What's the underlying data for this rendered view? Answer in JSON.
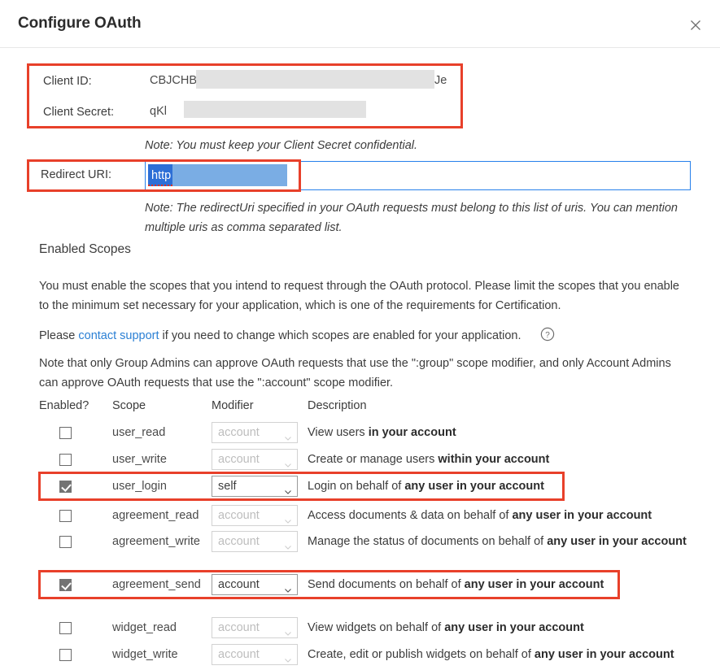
{
  "dialog": {
    "title": "Configure OAuth",
    "close_icon": "close-icon"
  },
  "credentials": {
    "client_id": {
      "label": "Client ID:",
      "value_prefix": "CBJCHBCA",
      "value_suffix": "Je"
    },
    "client_secret": {
      "label": "Client Secret:",
      "value_prefix": "qKl"
    },
    "note": "Note: You must keep your Client Secret confidential."
  },
  "redirect": {
    "label": "Redirect URI:",
    "value": "http",
    "note": "Note: The redirectUri specified in your OAuth requests must belong to this list of uris. You can mention multiple uris as comma separated list."
  },
  "scopes_section": {
    "title": "Enabled Scopes",
    "paragraph_1": "You must enable the scopes that you intend to request through the OAuth protocol. Please limit the scopes that you enable to the minimum set necessary for your application, which is one of the requirements for Certification.",
    "paragraph_2_before": "Please ",
    "paragraph_2_link": "contact support",
    "paragraph_2_after": " if you need to change which scopes are enabled for your application.",
    "help_icon": "help-circle-icon",
    "paragraph_3": "Note that only Group Admins can approve OAuth requests that use the \":group\" scope modifier, and only Account Admins can approve OAuth requests that use the \":account\" scope modifier."
  },
  "table": {
    "headers": {
      "enabled": "Enabled?",
      "scope": "Scope",
      "modifier": "Modifier",
      "description": "Description"
    },
    "rows": [
      {
        "checked": false,
        "scope": "user_read",
        "modifier": "account",
        "modifier_enabled": false,
        "desc_plain": "View users ",
        "desc_bold": "in your account",
        "desc_tail": "",
        "highlighted": false
      },
      {
        "checked": false,
        "scope": "user_write",
        "modifier": "account",
        "modifier_enabled": false,
        "desc_plain": "Create or manage users ",
        "desc_bold": "within your account",
        "desc_tail": "",
        "highlighted": false
      },
      {
        "checked": true,
        "scope": "user_login",
        "modifier": "self",
        "modifier_enabled": true,
        "desc_plain": "Login on behalf of ",
        "desc_bold": "any user in your account",
        "desc_tail": "",
        "highlighted": true
      },
      {
        "checked": false,
        "scope": "agreement_read",
        "modifier": "account",
        "modifier_enabled": false,
        "desc_plain": "Access documents & data on behalf of ",
        "desc_bold": "any user in your account",
        "desc_tail": "",
        "highlighted": false
      },
      {
        "checked": false,
        "scope": "agreement_write",
        "modifier": "account",
        "modifier_enabled": false,
        "desc_plain": "Manage the status of documents on behalf of ",
        "desc_bold": "any user in your account",
        "desc_tail": "",
        "highlighted": false
      },
      {
        "checked": true,
        "scope": "agreement_send",
        "modifier": "account",
        "modifier_enabled": true,
        "desc_plain": "Send documents on behalf of ",
        "desc_bold": "any user in your account",
        "desc_tail": "",
        "highlighted": true
      },
      {
        "checked": false,
        "scope": "widget_read",
        "modifier": "account",
        "modifier_enabled": false,
        "desc_plain": "View widgets on behalf of ",
        "desc_bold": "any user in your account",
        "desc_tail": "",
        "highlighted": false
      },
      {
        "checked": false,
        "scope": "widget_write",
        "modifier": "account",
        "modifier_enabled": false,
        "desc_plain": "Create, edit or publish widgets on behalf of ",
        "desc_bold": "any user in your account",
        "desc_tail": "",
        "highlighted": false
      }
    ]
  },
  "colors": {
    "annotation_red": "#e8402a",
    "link_blue": "#2a7fd4",
    "focus_blue": "#2680eb",
    "selection_blue": "#7aade4",
    "selection_token_blue": "#2d6fd6",
    "checkbox_fill": "#737373",
    "redaction_gray": "#e2e2e2"
  }
}
